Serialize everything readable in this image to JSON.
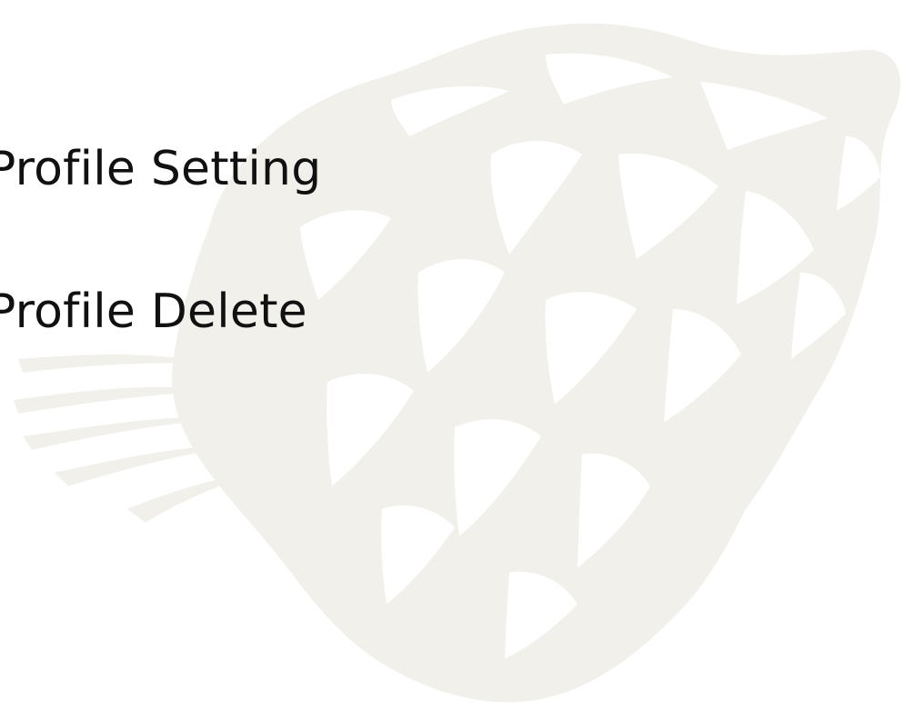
{
  "menu": {
    "items": [
      {
        "label": "Profile Setting"
      },
      {
        "label": "Profile Delete"
      }
    ]
  },
  "background": {
    "watermark_icon": "tiger-head-icon",
    "color": "#ffffff",
    "watermark_color": "#f1f0ea"
  }
}
